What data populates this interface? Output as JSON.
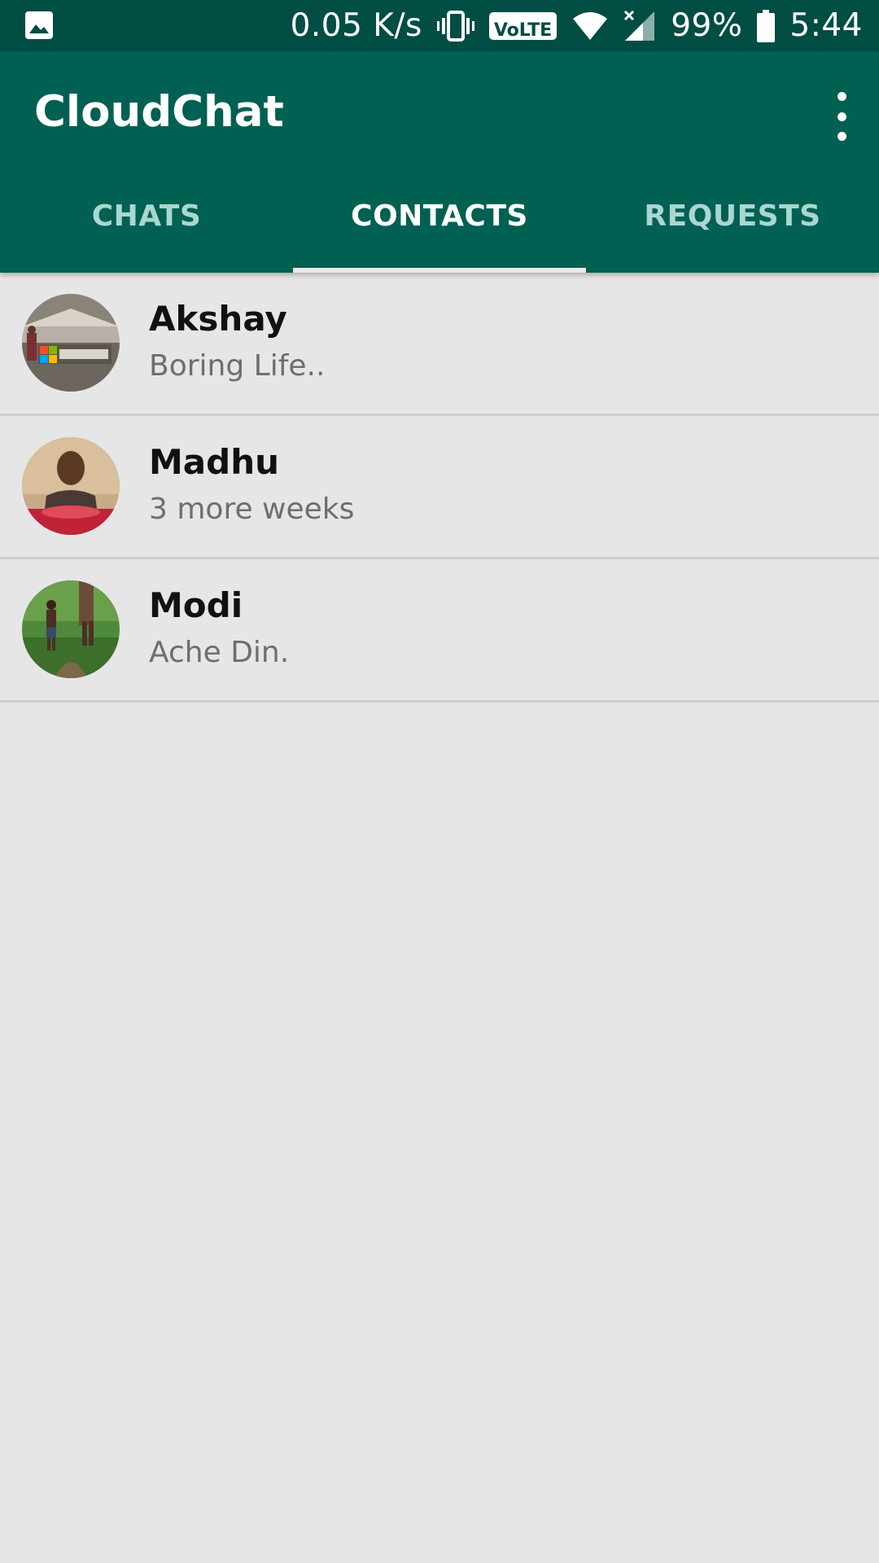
{
  "status_bar": {
    "net_speed": "0.05 K/s",
    "volte": "VoLTE",
    "battery": "99%",
    "time": "5:44",
    "icons": [
      "image-notification-icon",
      "vibrate-icon",
      "volte-icon",
      "wifi-icon",
      "signal-icon",
      "battery-icon"
    ]
  },
  "app_bar": {
    "title": "CloudChat",
    "menu_icon": "more-vert-icon"
  },
  "tabs": [
    {
      "label": "CHATS",
      "active": false
    },
    {
      "label": "CONTACTS",
      "active": true
    },
    {
      "label": "REQUESTS",
      "active": false
    }
  ],
  "contacts": [
    {
      "name": "Akshay",
      "status": "Boring Life.."
    },
    {
      "name": "Madhu",
      "status": "3 more weeks"
    },
    {
      "name": "Modi",
      "status": "Ache Din."
    }
  ],
  "colors": {
    "status_bar": "#004d44",
    "app_bar": "#006052",
    "background": "#e6e6e6",
    "tab_inactive": "#a9d7cf",
    "tab_indicator": "#e9e9e9"
  }
}
